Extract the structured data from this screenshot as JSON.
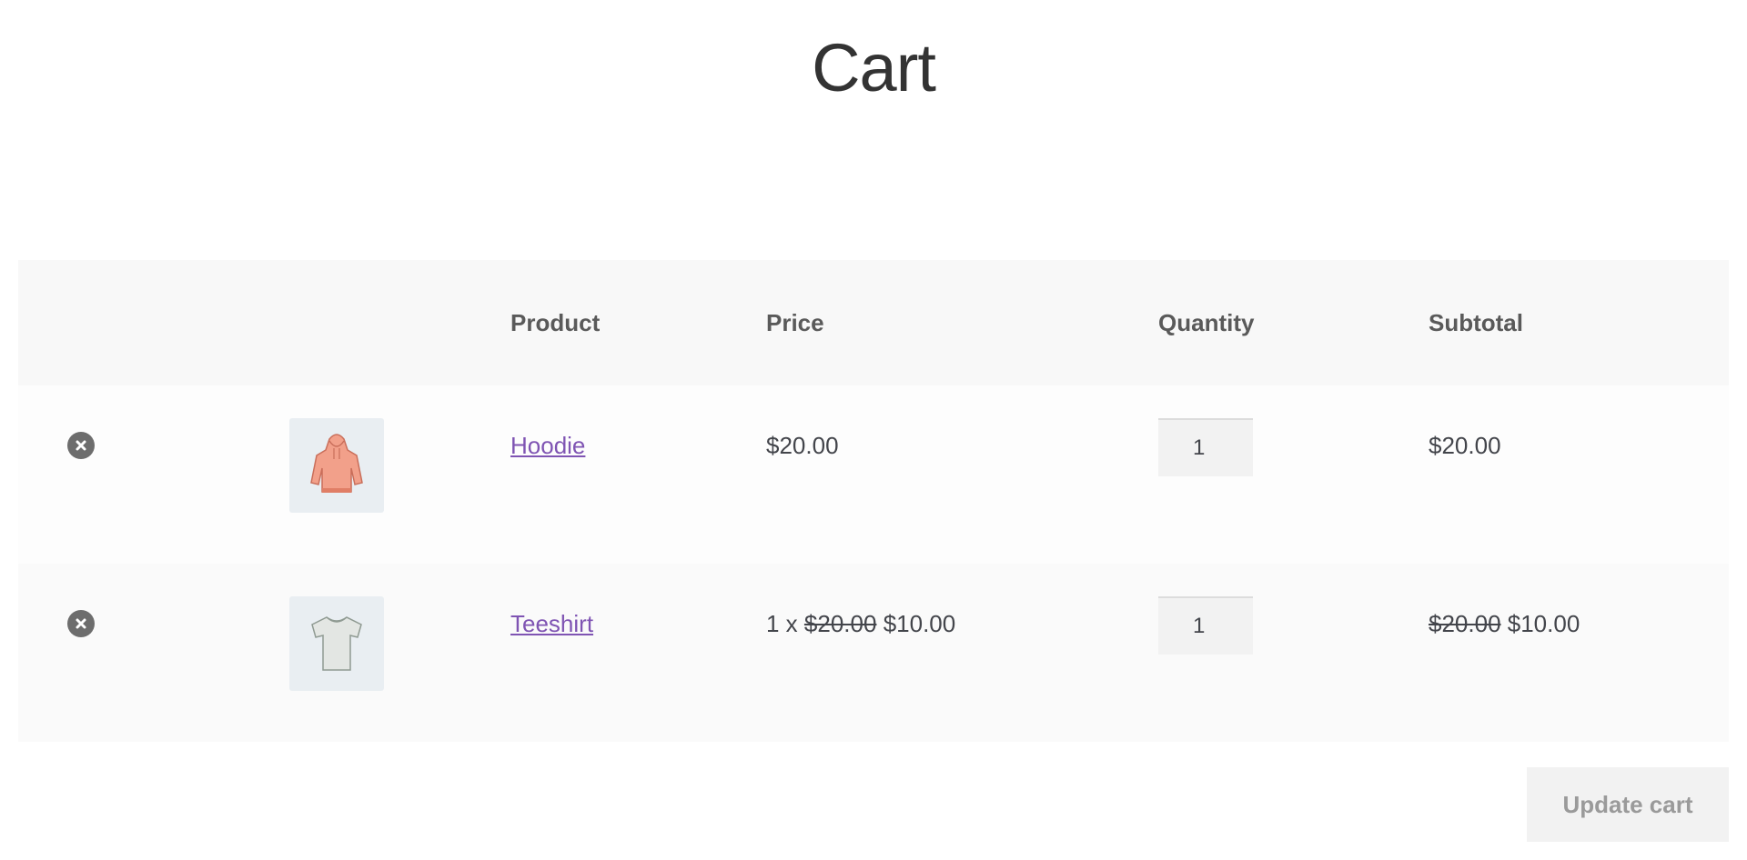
{
  "page": {
    "title": "Cart"
  },
  "table": {
    "headers": {
      "product": "Product",
      "price": "Price",
      "quantity": "Quantity",
      "subtotal": "Subtotal"
    },
    "rows": [
      {
        "product": "Hoodie",
        "price": "$20.00",
        "price_prefix": "",
        "price_original": "",
        "quantity": "1",
        "subtotal_original": "",
        "subtotal": "$20.00",
        "thumbnail_icon": "hoodie-icon"
      },
      {
        "product": "Teeshirt",
        "price_prefix": "1 x",
        "price_original": "$20.00",
        "price": "$10.00",
        "quantity": "1",
        "subtotal_original": "$20.00",
        "subtotal": "$10.00",
        "thumbnail_icon": "teeshirt-icon"
      }
    ]
  },
  "actions": {
    "update_cart": "Update cart"
  },
  "colors": {
    "link": "#7f54b3",
    "header_bg": "#f8f8f8",
    "button_bg": "#f2f2f2"
  }
}
